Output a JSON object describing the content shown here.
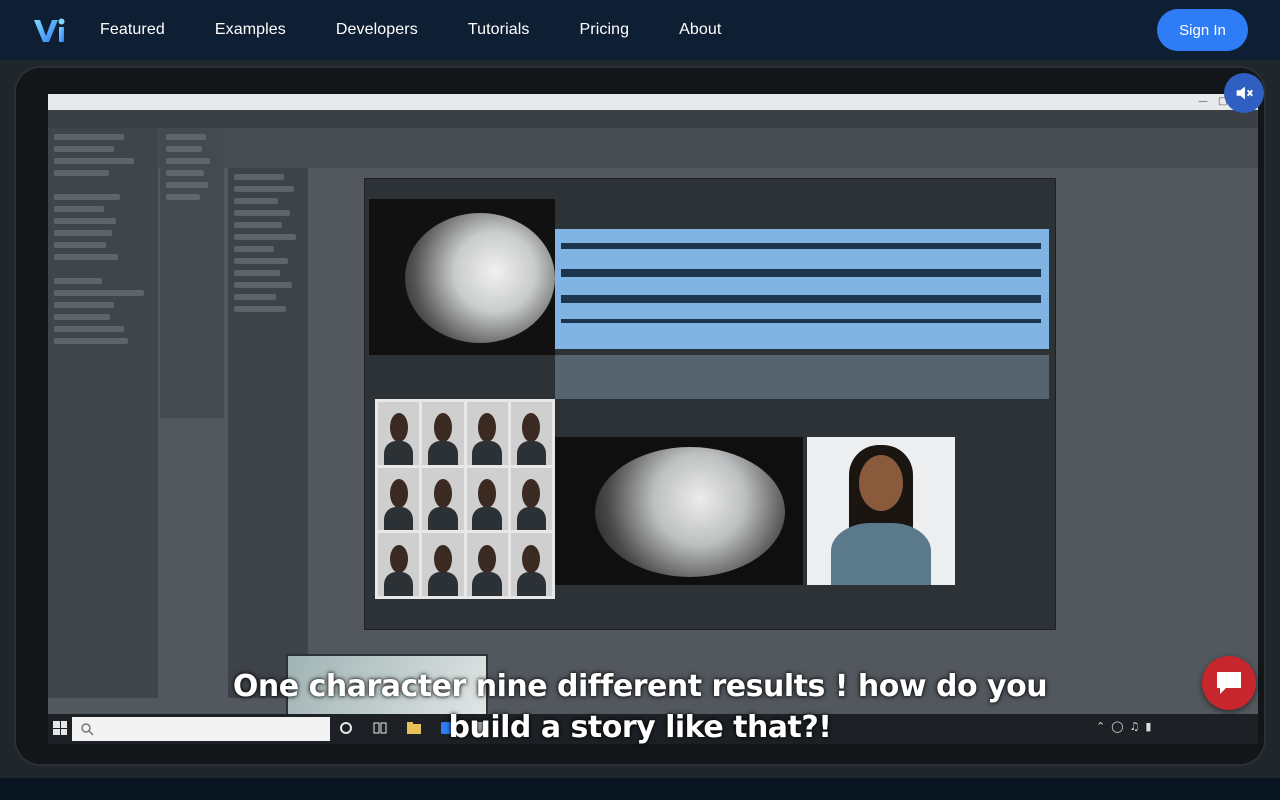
{
  "nav": {
    "logo_text": "Vi",
    "links": [
      "Featured",
      "Examples",
      "Developers",
      "Tutorials",
      "Pricing",
      "About"
    ],
    "sign_in": "Sign In"
  },
  "video": {
    "mute_icon": "speaker-mute-icon",
    "caption_lines": [
      "One character nine different results ! how do you",
      "build a story like that?!"
    ]
  },
  "chat": {
    "icon": "chat-bubble-icon"
  },
  "colors": {
    "nav_bg": "#0f1f33",
    "sign_in_bg": "#2f7df6",
    "mute_bg": "#2f5fc0",
    "chat_bg": "#c8262d"
  }
}
